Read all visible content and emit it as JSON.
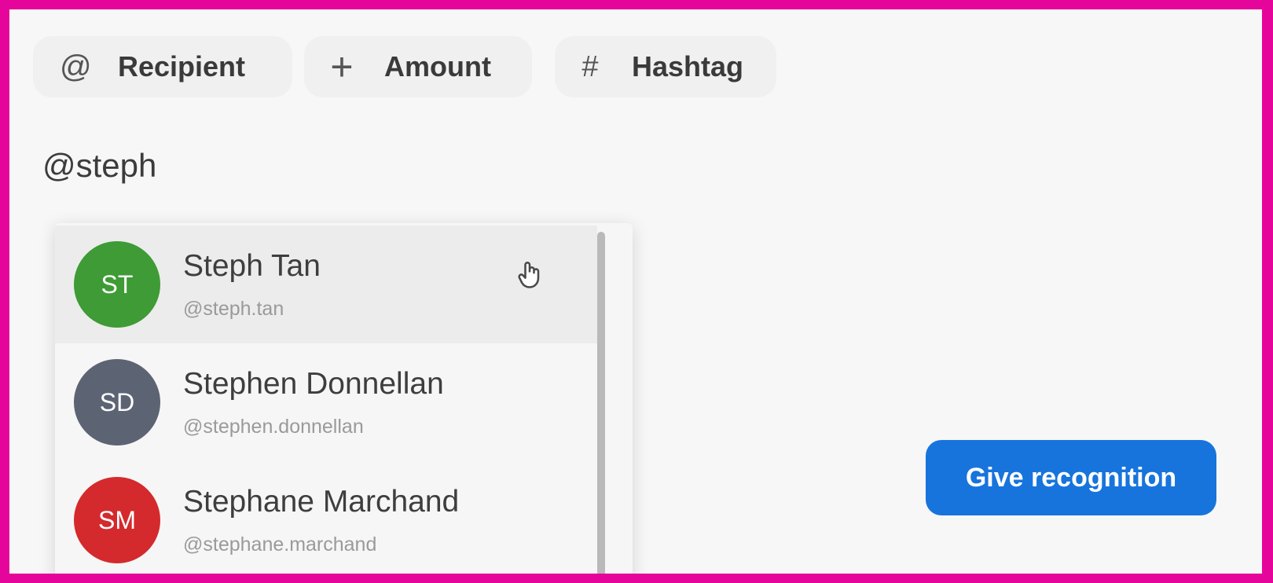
{
  "toolbar": {
    "recipient": {
      "icon": "at-icon",
      "glyph": "@",
      "label": "Recipient"
    },
    "amount": {
      "icon": "plus-icon",
      "glyph": "+",
      "label": "Amount"
    },
    "hashtag": {
      "icon": "hash-icon",
      "glyph": "#",
      "label": "Hashtag"
    }
  },
  "composer": {
    "text": "@steph"
  },
  "suggestions": [
    {
      "initials": "ST",
      "name": "Steph Tan",
      "handle": "@steph.tan",
      "color": "#3e9b35",
      "highlighted": true
    },
    {
      "initials": "SD",
      "name": "Stephen Donnellan",
      "handle": "@stephen.donnellan",
      "color": "#5c6474",
      "highlighted": false
    },
    {
      "initials": "SM",
      "name": "Stephane Marchand",
      "handle": "@stephane.marchand",
      "color": "#d42a2d",
      "highlighted": false
    }
  ],
  "actions": {
    "give_recognition": "Give recognition"
  },
  "colors": {
    "accent": "#1774dd",
    "frame": "#e6059a"
  }
}
